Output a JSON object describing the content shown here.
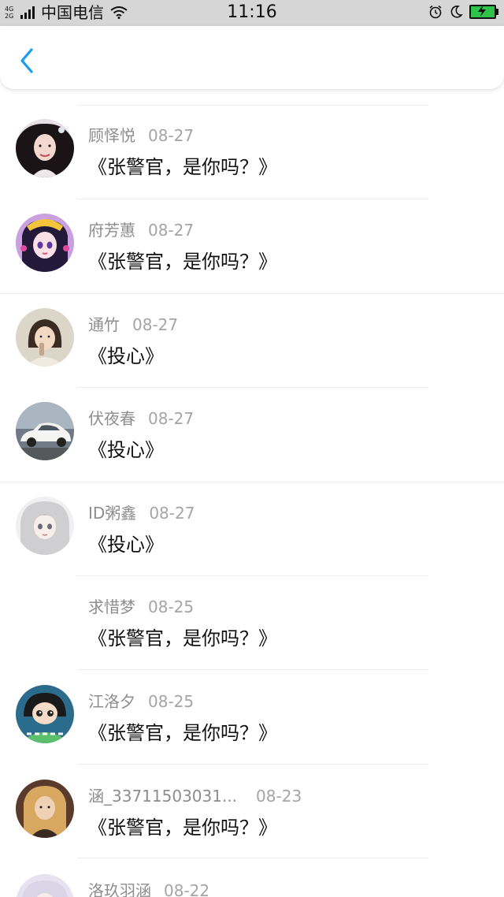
{
  "status_bar": {
    "network_top": "4G",
    "network_bottom": "2G",
    "carrier": "中国电信",
    "time": "11:16"
  },
  "icons": {
    "back": "chevron-left-icon",
    "alarm": "alarm-clock-icon",
    "moon": "moon-icon",
    "battery": "battery-charging-icon",
    "wifi": "wifi-icon"
  },
  "colors": {
    "accent": "#1a9cf2",
    "statusbar_bg": "#d6d6d6",
    "battery": "#2ec24a",
    "name_text": "#8d8d8d",
    "title_text": "#111111"
  },
  "items": [
    {
      "name": "顾怿悦",
      "date": "08-27",
      "title": "《张警官，是你吗？》",
      "avatar": "avatar-girl-portrait"
    },
    {
      "name": "府芳蕙",
      "date": "08-27",
      "title": "《张警官，是你吗？》",
      "avatar": "avatar-anime-princess"
    },
    {
      "name": "通竹",
      "date": "08-27",
      "title": "《投心》",
      "avatar": "avatar-child-photo"
    },
    {
      "name": "伏夜春",
      "date": "08-27",
      "title": "《投心》",
      "avatar": "avatar-white-car"
    },
    {
      "name": "ID粥鑫",
      "date": "08-27",
      "title": "《投心》",
      "avatar": "avatar-anime-silver-hair"
    },
    {
      "name": "求惜梦",
      "date": "08-25",
      "title": "《张警官，是你吗？》",
      "avatar": ""
    },
    {
      "name": "江洛夕",
      "date": "08-25",
      "title": "《张警官，是你吗？》",
      "avatar": "avatar-cartoon-boy"
    },
    {
      "name": "涵_33711503031...",
      "date": "08-23",
      "title": "《张警官，是你吗？》",
      "avatar": "avatar-blonde-girl"
    },
    {
      "name": "洛玖羽涵",
      "date": "08-22",
      "title": "",
      "avatar": "avatar-partial"
    }
  ]
}
